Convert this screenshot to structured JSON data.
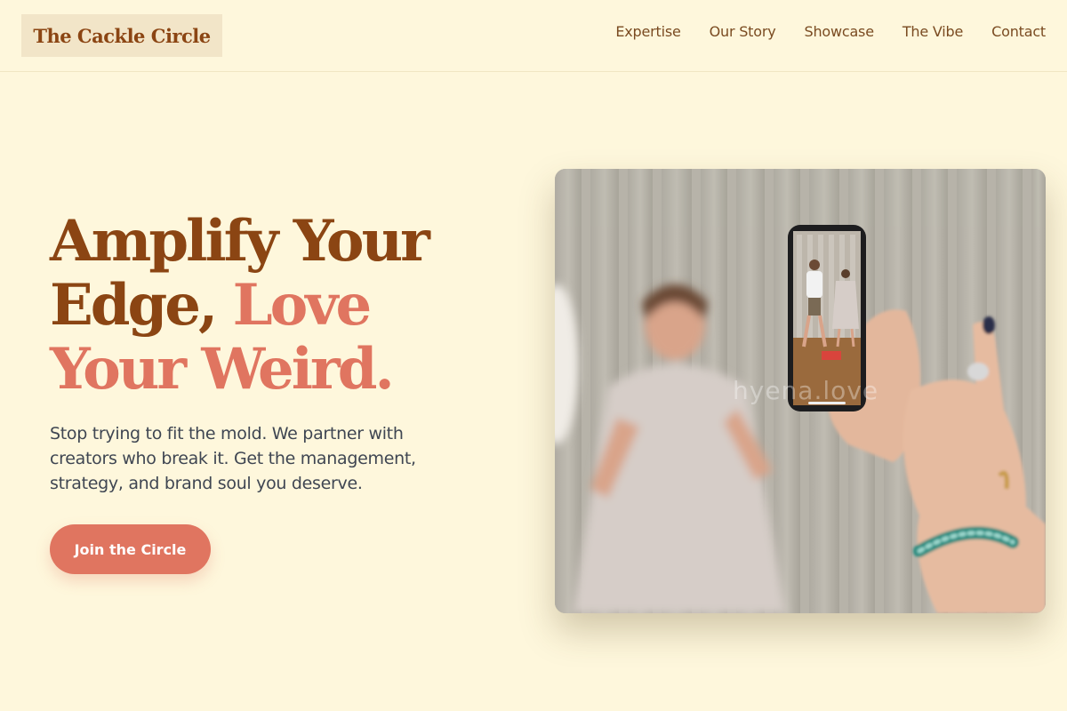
{
  "brand": {
    "name": "The Cackle Circle"
  },
  "nav": {
    "links": [
      {
        "label": "Expertise"
      },
      {
        "label": "Our Story"
      },
      {
        "label": "Showcase"
      },
      {
        "label": "The Vibe"
      },
      {
        "label": "Contact"
      }
    ]
  },
  "hero": {
    "title_part1": "Amplify Your Edge, ",
    "title_part2": "Love Your Weird.",
    "subtitle": "Stop trying to fit the mold. We partner with creators who break it. Get the management, strategy, and brand soul you deserve.",
    "cta_label": "Join the Circle"
  },
  "photo": {
    "watermark": "hyena.love"
  },
  "colors": {
    "background": "#fef7dc",
    "brand_brown": "#8b4513",
    "accent_coral": "#e07560",
    "body_text": "#3f4652"
  }
}
